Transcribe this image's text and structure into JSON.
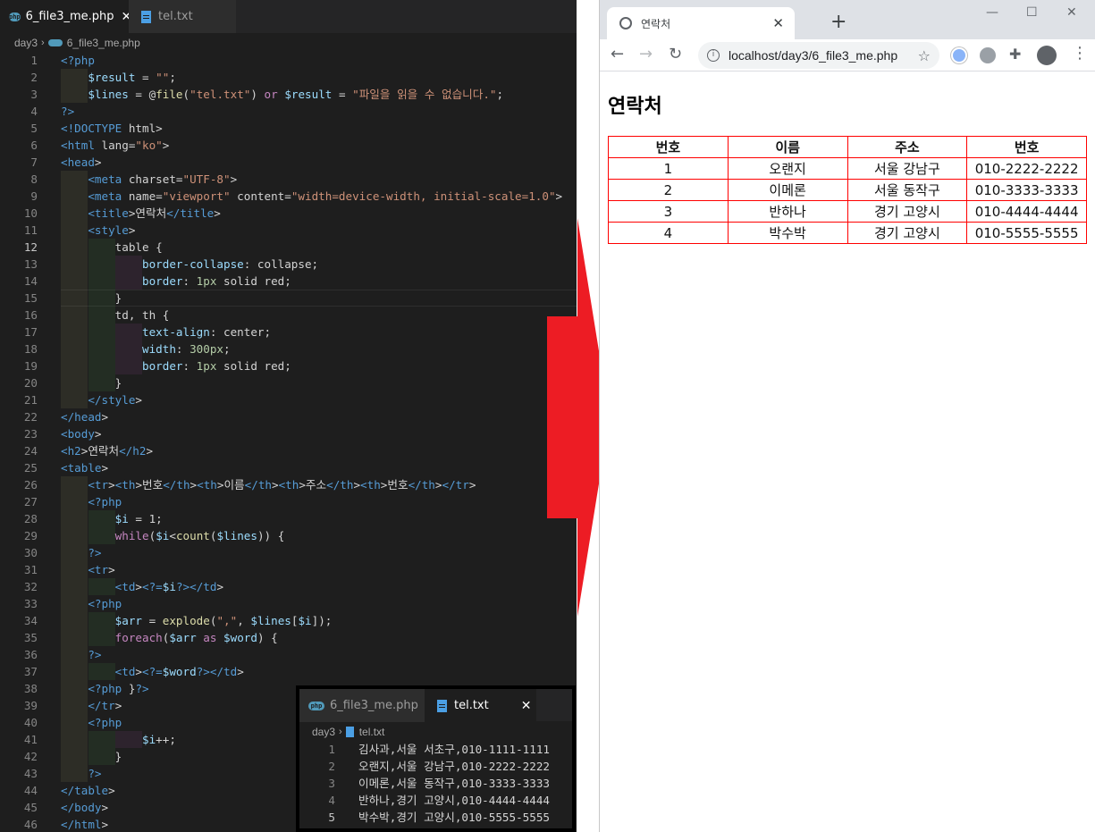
{
  "editor": {
    "tabs": [
      {
        "label": "6_file3_me.php",
        "active": true,
        "icon": "php-file-icon"
      },
      {
        "label": "tel.txt",
        "active": false,
        "icon": "text-file-icon"
      }
    ],
    "breadcrumb": {
      "folder": "day3",
      "file": "6_file3_me.php"
    },
    "line_numbers": [
      "1",
      "2",
      "3",
      "4",
      "5",
      "6",
      "7",
      "8",
      "9",
      "10",
      "11",
      "12",
      "13",
      "14",
      "15",
      "16",
      "17",
      "18",
      "19",
      "20",
      "21",
      "22",
      "23",
      "24",
      "25",
      "26",
      "27",
      "28",
      "29",
      "30",
      "31",
      "32",
      "33",
      "34",
      "35",
      "36",
      "37",
      "38",
      "39",
      "40",
      "41",
      "42",
      "43",
      "44",
      "45",
      "46"
    ],
    "current_line": "12",
    "code_lines": [
      "<?php",
      "    $result = \"\";",
      "    $lines = @file(\"tel.txt\") or $result = \"파일을 읽을 수 없습니다.\";",
      "?>",
      "<!DOCTYPE html>",
      "<html lang=\"ko\">",
      "<head>",
      "    <meta charset=\"UTF-8\">",
      "    <meta name=\"viewport\" content=\"width=device-width, initial-scale=1.0\">",
      "    <title>연락처</title>",
      "    <style>",
      "        table {",
      "            border-collapse: collapse;",
      "            border: 1px solid red;",
      "        }",
      "        td, th {",
      "            text-align: center;",
      "            width: 300px;",
      "            border: 1px solid red;",
      "        }",
      "    </style>",
      "</head>",
      "<body>",
      "<h2>연락처</h2>",
      "<table>",
      "    <tr><th>번호</th><th>이름</th><th>주소</th><th>번호</th></tr>",
      "    <?php",
      "        $i = 1;",
      "        while($i<count($lines)) {",
      "    ?>",
      "    <tr>",
      "        <td><?=$i?></td>",
      "    <?php",
      "        $arr = explode(\",\", $lines[$i]);",
      "        foreach($arr as $word) {",
      "    ?>",
      "        <td><?=$word?></td>",
      "    <?php }?>",
      "    </tr>",
      "    <?php",
      "            $i++;",
      "        }",
      "    ?>",
      "</table>",
      "</body>",
      "</html>"
    ]
  },
  "inset": {
    "tabs": [
      {
        "label": "6_file3_me.php",
        "active": false,
        "icon": "php-file-icon"
      },
      {
        "label": "tel.txt",
        "active": true,
        "icon": "text-file-icon"
      }
    ],
    "breadcrumb": {
      "folder": "day3",
      "file": "tel.txt"
    },
    "line_numbers": [
      "1",
      "2",
      "3",
      "4",
      "5"
    ],
    "lines": [
      "김사과,서울 서초구,010-1111-1111",
      "오랜지,서울 강남구,010-2222-2222",
      "이메론,서울 동작구,010-3333-3333",
      "반하나,경기 고양시,010-4444-4444",
      "박수박,경기 고양시,010-5555-5555"
    ]
  },
  "arrow_color": "#ed1c24",
  "browser": {
    "tab_title": "연락처",
    "url": "localhost/day3/6_file3_me.php",
    "page": {
      "heading": "연락처",
      "table": {
        "headers": [
          "번호",
          "이름",
          "주소",
          "번호"
        ],
        "rows": [
          [
            "1",
            "오랜지",
            "서울 강남구",
            "010-2222-2222"
          ],
          [
            "2",
            "이메론",
            "서울 동작구",
            "010-3333-3333"
          ],
          [
            "3",
            "반하나",
            "경기 고양시",
            "010-4444-4444"
          ],
          [
            "4",
            "박수박",
            "경기 고양시",
            "010-5555-5555"
          ]
        ]
      }
    }
  }
}
